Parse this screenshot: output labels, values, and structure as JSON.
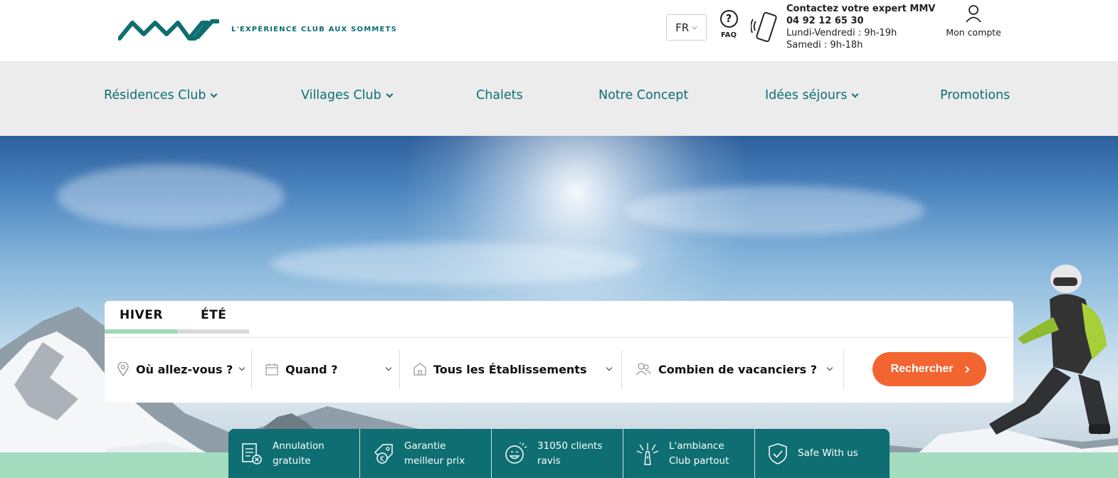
{
  "header": {
    "tagline": "L'EXPÉRIENCE CLUB AUX SOMMETS",
    "language": "FR",
    "faq_label": "FAQ",
    "contact_title": "Contactez votre expert MMV",
    "contact_phone": "04 92 12 65 30",
    "hours_weekday": "Lundi-Vendredi : 9h-19h",
    "hours_saturday": "Samedi : 9h-18h",
    "account_label": "Mon compte"
  },
  "nav": {
    "items": [
      {
        "label": "Résidences Club",
        "dropdown": true
      },
      {
        "label": "Villages Club",
        "dropdown": true
      },
      {
        "label": "Chalets",
        "dropdown": false
      },
      {
        "label": "Notre Concept",
        "dropdown": false
      },
      {
        "label": "Idées séjours",
        "dropdown": true
      },
      {
        "label": "Promotions",
        "dropdown": false
      }
    ]
  },
  "search": {
    "tabs": [
      "HIVER",
      "ÉTÉ"
    ],
    "active_tab": "HIVER",
    "destination": "Où allez-vous ?",
    "dates": "Quand ?",
    "establishments": "Tous les Établissements",
    "guests": "Combien de vacanciers ?",
    "submit": "Rechercher"
  },
  "reassurance": {
    "items": [
      {
        "line1": "Annulation",
        "line2": "gratuite",
        "icon": "document-cancel-icon"
      },
      {
        "line1": "Garantie",
        "line2": "meilleur prix",
        "icon": "euro-tag-icon"
      },
      {
        "line1": "31050 clients",
        "line2": "ravis",
        "icon": "smile-icon"
      },
      {
        "line1": "L'ambiance",
        "line2": "Club partout",
        "icon": "party-icon"
      },
      {
        "line1": "Safe With us",
        "line2": "",
        "icon": "shield-check-icon"
      }
    ]
  },
  "colors": {
    "brand_teal": "#0e6e71",
    "accent_orange": "#f26430",
    "mint": "#a4dcc0",
    "nav_bg": "#ececec"
  }
}
